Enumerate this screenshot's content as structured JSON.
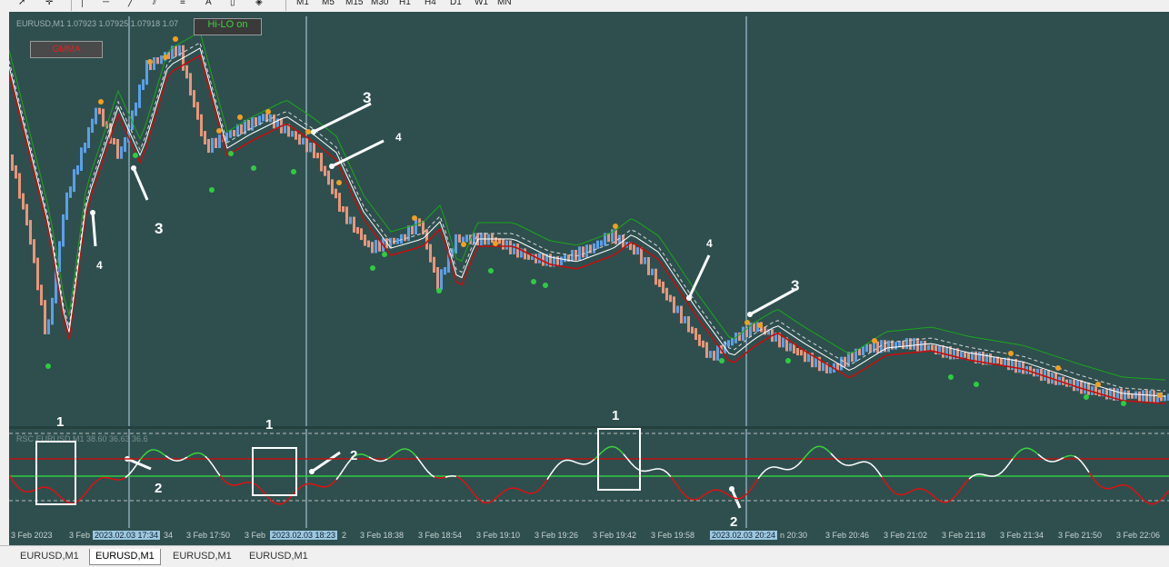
{
  "toolbar": {
    "timeframes": [
      "M1",
      "M5",
      "M15",
      "M30",
      "H1",
      "H4",
      "D1",
      "W1",
      "MN"
    ],
    "tools_text": [
      "A"
    ]
  },
  "chart": {
    "header": "EURUSD,M1  1.07923 1.07925 1.07918 1.07",
    "hilo_button": "Hi-LO on",
    "gmma_button": "GMMA",
    "indicator_header": "RSC EURUSD,M1  38.60 36.63 36.6",
    "annotations": [
      "1",
      "2",
      "3",
      "4",
      "3",
      "4",
      "1",
      "2",
      "3",
      "4",
      "1",
      "2",
      "2"
    ],
    "time_labels": [
      "3 Feb 2023",
      "3 Feb",
      "2023.02.03 17:34",
      "34",
      "3 Feb 17:50",
      "3 Feb",
      "2023.02.03 18:23",
      "2",
      "3 Feb 18:38",
      "3 Feb 18:54",
      "3 Feb 19:10",
      "3 Feb 19:26",
      "3 Feb 19:42",
      "3 Feb 19:58",
      "2023.02.03 20:24",
      "n 20:30",
      "3 Feb 20:46",
      "3 Feb 21:02",
      "3 Feb 21:18",
      "3 Feb 21:34",
      "3 Feb 21:50",
      "3 Feb 22:06"
    ]
  },
  "tabs": [
    "EURUSD,M1",
    "EURUSD,M1",
    "EURUSD,M1",
    "EURUSD,M1"
  ],
  "colors": {
    "background": "#2f4f4f",
    "bull": "#5aa0e8",
    "bear": "#e8967a",
    "green_line": "#1aa61a",
    "red_line": "#c01010"
  }
}
